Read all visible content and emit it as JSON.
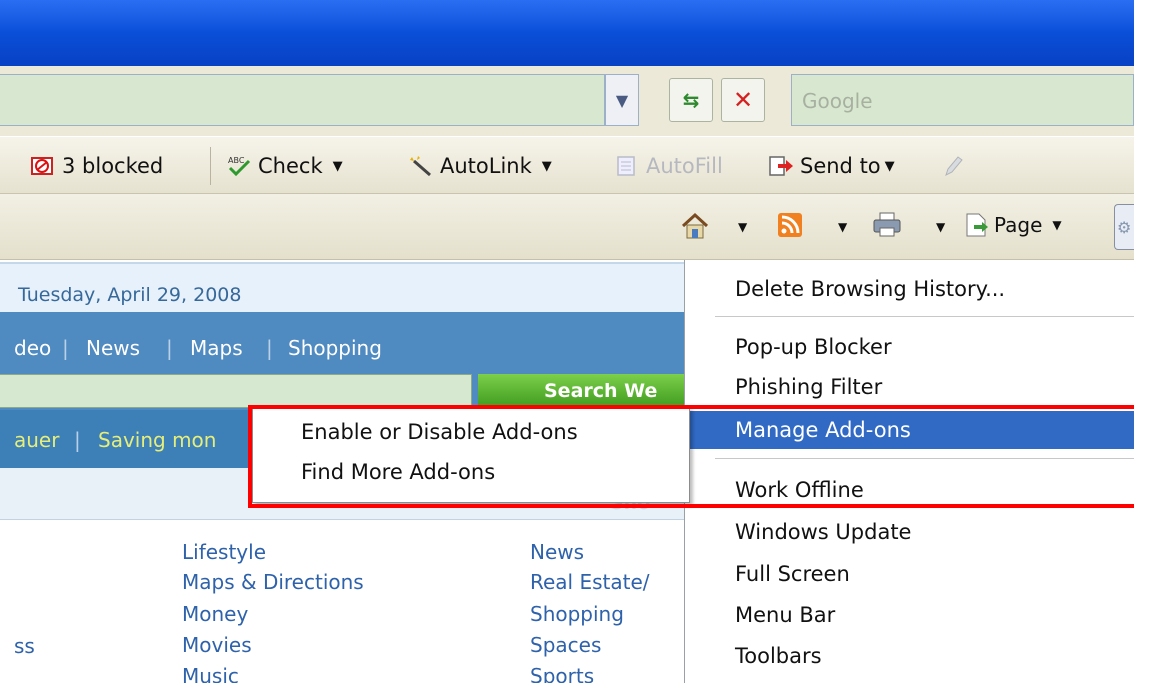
{
  "colors": {
    "title_blue": "#0a4fd8",
    "highlight": "#316ac5",
    "annotation": "#ff0000"
  },
  "addressbar": {
    "dropdown_icon": "chevron-down-icon",
    "go_icon": "refresh-arrows-icon",
    "stop_icon": "close-icon"
  },
  "search": {
    "placeholder": "Google"
  },
  "toolbar": {
    "blocked_label": "3 blocked",
    "check_label": "Check",
    "autolink_label": "AutoLink",
    "autofill_label": "AutoFill",
    "sendto_label": "Send to"
  },
  "command_bar": {
    "page_label": "Page"
  },
  "page": {
    "date": "Tuesday, April 29, 2008",
    "nav": [
      "deo",
      "News",
      "Maps",
      "Shopping"
    ],
    "search_button": "Search We",
    "teasers": [
      "auer",
      "Saving mon"
    ],
    "gray_text": "Sho",
    "links_col1": [
      "ss"
    ],
    "links_col2": [
      "Lifestyle",
      "Maps & Directions",
      "Money",
      "Movies",
      "Music"
    ],
    "links_col3": [
      "News",
      "Real Estate/",
      "Shopping",
      "Spaces",
      "Sports"
    ]
  },
  "tools_menu": {
    "items": [
      "Delete Browsing History...",
      "Pop-up Blocker",
      "Phishing Filter",
      "Manage Add-ons",
      "Work Offline",
      "Windows Update",
      "Full Screen",
      "Menu Bar",
      "Toolbars"
    ]
  },
  "submenu": {
    "items": [
      "Enable or Disable Add-ons",
      "Find More Add-ons"
    ]
  }
}
